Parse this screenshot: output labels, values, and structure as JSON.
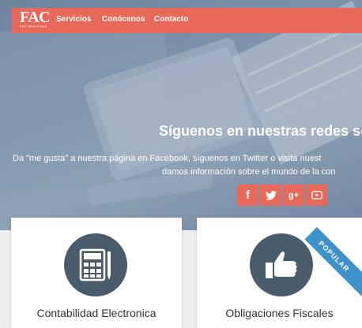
{
  "brand": {
    "logo_text": "FAC",
    "logo_subtext": "FAC SERVICIOS"
  },
  "nav": {
    "items": [
      {
        "label": "Servicios"
      },
      {
        "label": "Conócenos"
      },
      {
        "label": "Contacto"
      }
    ]
  },
  "hero": {
    "title": "Síguenos en nuestras redes so",
    "line1": "Da \"me gusta\" a nuestra página en Facebook, síguenos en Twitter o visita nuest",
    "line2": "damos información sobre el mundo de la con"
  },
  "social": [
    {
      "name": "facebook",
      "icon": "facebook-icon",
      "glyph": "f"
    },
    {
      "name": "twitter",
      "icon": "twitter-icon"
    },
    {
      "name": "google-plus",
      "icon": "google-plus-icon",
      "glyph": "g+"
    },
    {
      "name": "youtube",
      "icon": "youtube-icon"
    }
  ],
  "cards": [
    {
      "title": "Contabilidad Electronica",
      "icon": "calculator-icon"
    },
    {
      "title": "Obligaciones Fiscales",
      "icon": "thumbs-up-icon",
      "ribbon": "POPULAR"
    }
  ],
  "colors": {
    "accent": "#e8695a",
    "icon_circle": "#4a5b6b",
    "ribbon": "#3d93c9"
  }
}
